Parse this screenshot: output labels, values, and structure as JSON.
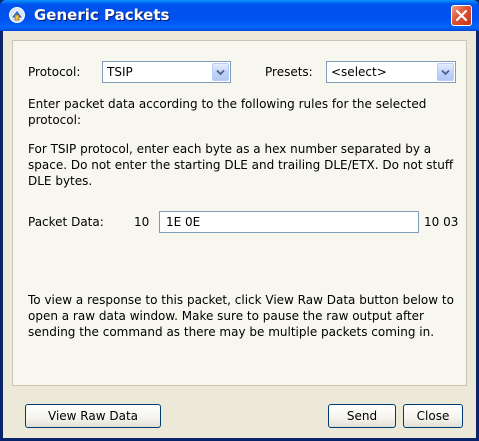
{
  "window": {
    "title": "Generic Packets",
    "app_icon": "packet-icon",
    "close_icon": "close-icon"
  },
  "protocol": {
    "label": "Protocol:",
    "value": "TSIP"
  },
  "presets": {
    "label": "Presets:",
    "value": "<select>"
  },
  "instructions": {
    "intro": "Enter packet data according to the following rules for the selected protocol:",
    "rules": "For TSIP protocol, enter each byte as a hex number separated by a space. Do not enter the starting DLE and trailing DLE/ETX. Do not stuff DLE bytes."
  },
  "packet": {
    "label": "Packet Data:",
    "prefix": "10",
    "value": "1E 0E",
    "suffix": "10 03"
  },
  "response_note": "To view a response to this packet, click View Raw Data button below to open a raw data window. Make sure to pause the raw output after sending the command as there may be multiple packets coming in.",
  "buttons": {
    "view_raw": "View Raw Data",
    "send": "Send",
    "close": "Close"
  },
  "colors": {
    "titlebar": "#0053ee",
    "dialog_bg": "#ece9d8",
    "close_button": "#e0512f"
  }
}
